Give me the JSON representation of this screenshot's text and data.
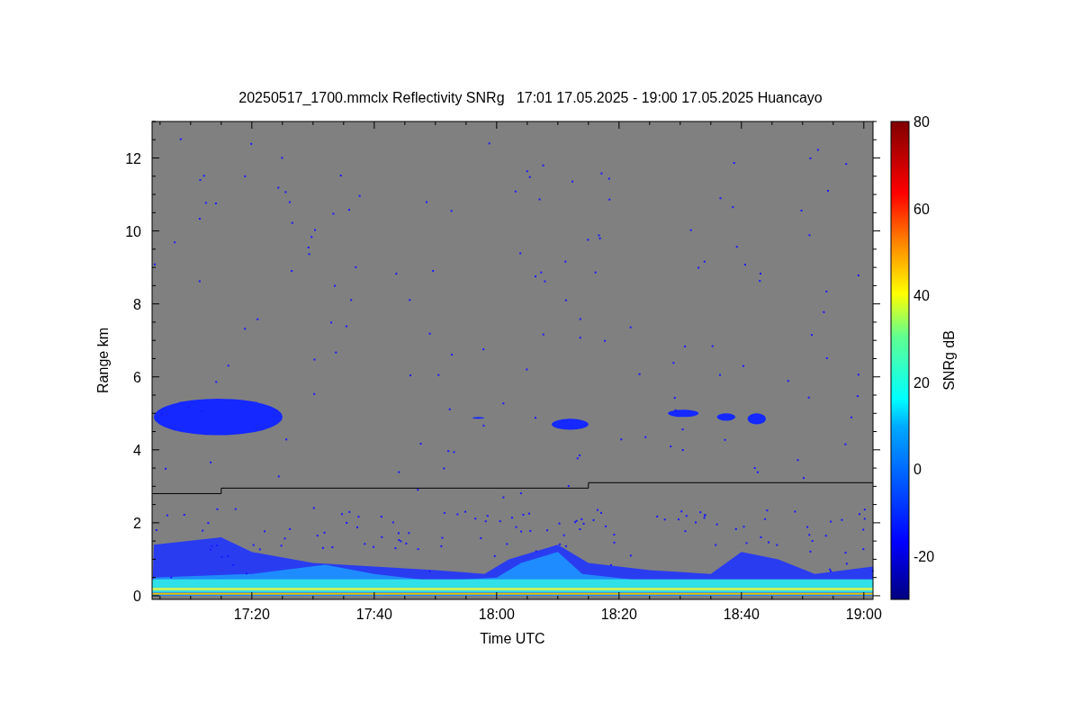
{
  "title": "20250517_1700.mmclx Reflectivity SNRg   17:01 17.05.2025 - 19:00 17.05.2025 Huancayo",
  "x_axis": {
    "label": "Time UTC",
    "ticks": [
      "17:20",
      "17:40",
      "18:00",
      "18:20",
      "18:40",
      "19:00"
    ]
  },
  "y_axis": {
    "label": "Range km",
    "ticks": [
      "12",
      "10",
      "8",
      "6",
      "4",
      "2",
      "0"
    ]
  },
  "colorbar": {
    "label": "SNRg dB",
    "ticks": [
      "80",
      "60",
      "40",
      "20",
      "0",
      "-20"
    ]
  }
}
